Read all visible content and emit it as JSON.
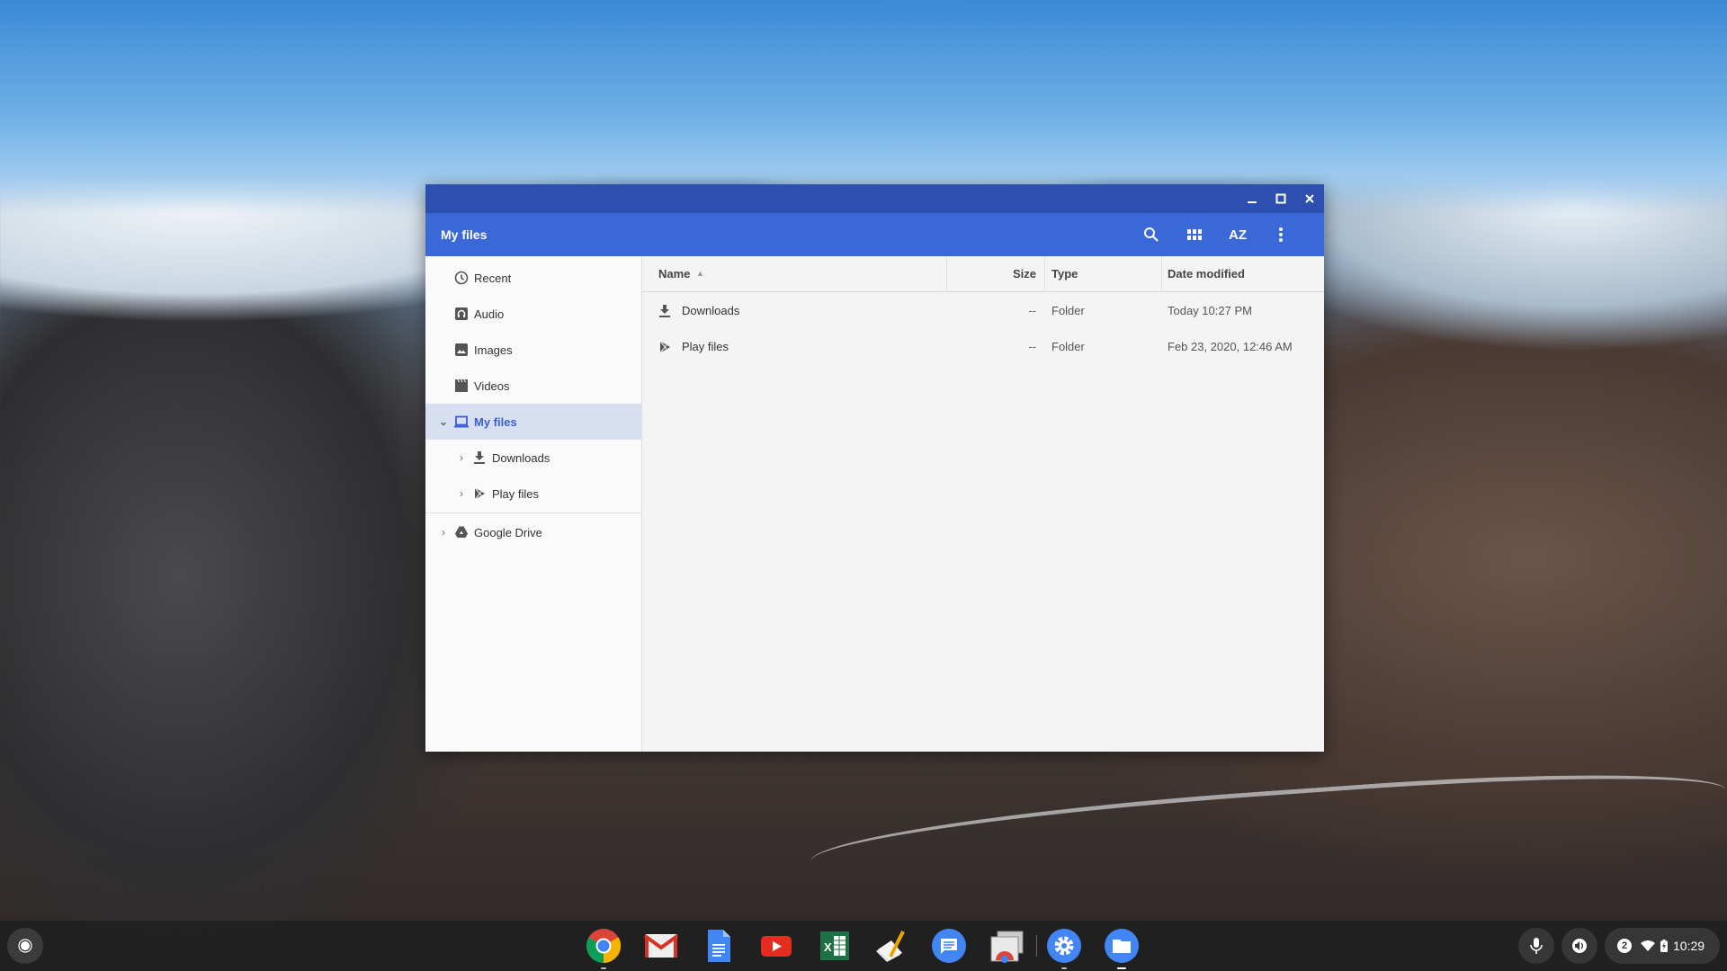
{
  "window": {
    "title": "My files",
    "controls": {
      "minimize": "minimize-icon",
      "maximize": "maximize-icon",
      "close": "close-icon"
    },
    "toolbar": [
      {
        "name": "search-button",
        "icon": "search-icon"
      },
      {
        "name": "grid-view-button",
        "icon": "grid-view-icon"
      },
      {
        "name": "sort-button",
        "icon": "sort-az-icon",
        "label": "AZ"
      },
      {
        "name": "more-button",
        "icon": "more-vert-icon"
      }
    ]
  },
  "sidebar": {
    "items": [
      {
        "label": "Recent",
        "icon": "clock-icon"
      },
      {
        "label": "Audio",
        "icon": "headphones-icon"
      },
      {
        "label": "Images",
        "icon": "image-icon"
      },
      {
        "label": "Videos",
        "icon": "clapperboard-icon"
      },
      {
        "label": "My files",
        "icon": "laptop-icon",
        "expanded": true,
        "selected": true
      },
      {
        "label": "Downloads",
        "icon": "download-icon",
        "child": true
      },
      {
        "label": "Play files",
        "icon": "play-store-icon",
        "child": true
      },
      {
        "label": "Google Drive",
        "icon": "google-drive-icon"
      }
    ]
  },
  "table": {
    "columns": [
      {
        "label": "Name",
        "sort": "ascending"
      },
      {
        "label": "Size"
      },
      {
        "label": "Type"
      },
      {
        "label": "Date modified"
      }
    ],
    "rows": [
      {
        "name": "Downloads",
        "icon": "download-icon",
        "size": "--",
        "type": "Folder",
        "modified": "Today 10:27 PM"
      },
      {
        "name": "Play files",
        "icon": "play-store-icon",
        "size": "--",
        "type": "Folder",
        "modified": "Feb 23, 2020, 12:46 AM"
      }
    ]
  },
  "shelf": {
    "apps": [
      "Chrome",
      "Gmail",
      "Google Docs",
      "YouTube",
      "Excel",
      "Text editor",
      "Messages",
      "Chrome Remote Desktop",
      "Settings",
      "Files"
    ],
    "status": {
      "notifications": "2",
      "time": "10:29"
    }
  }
}
